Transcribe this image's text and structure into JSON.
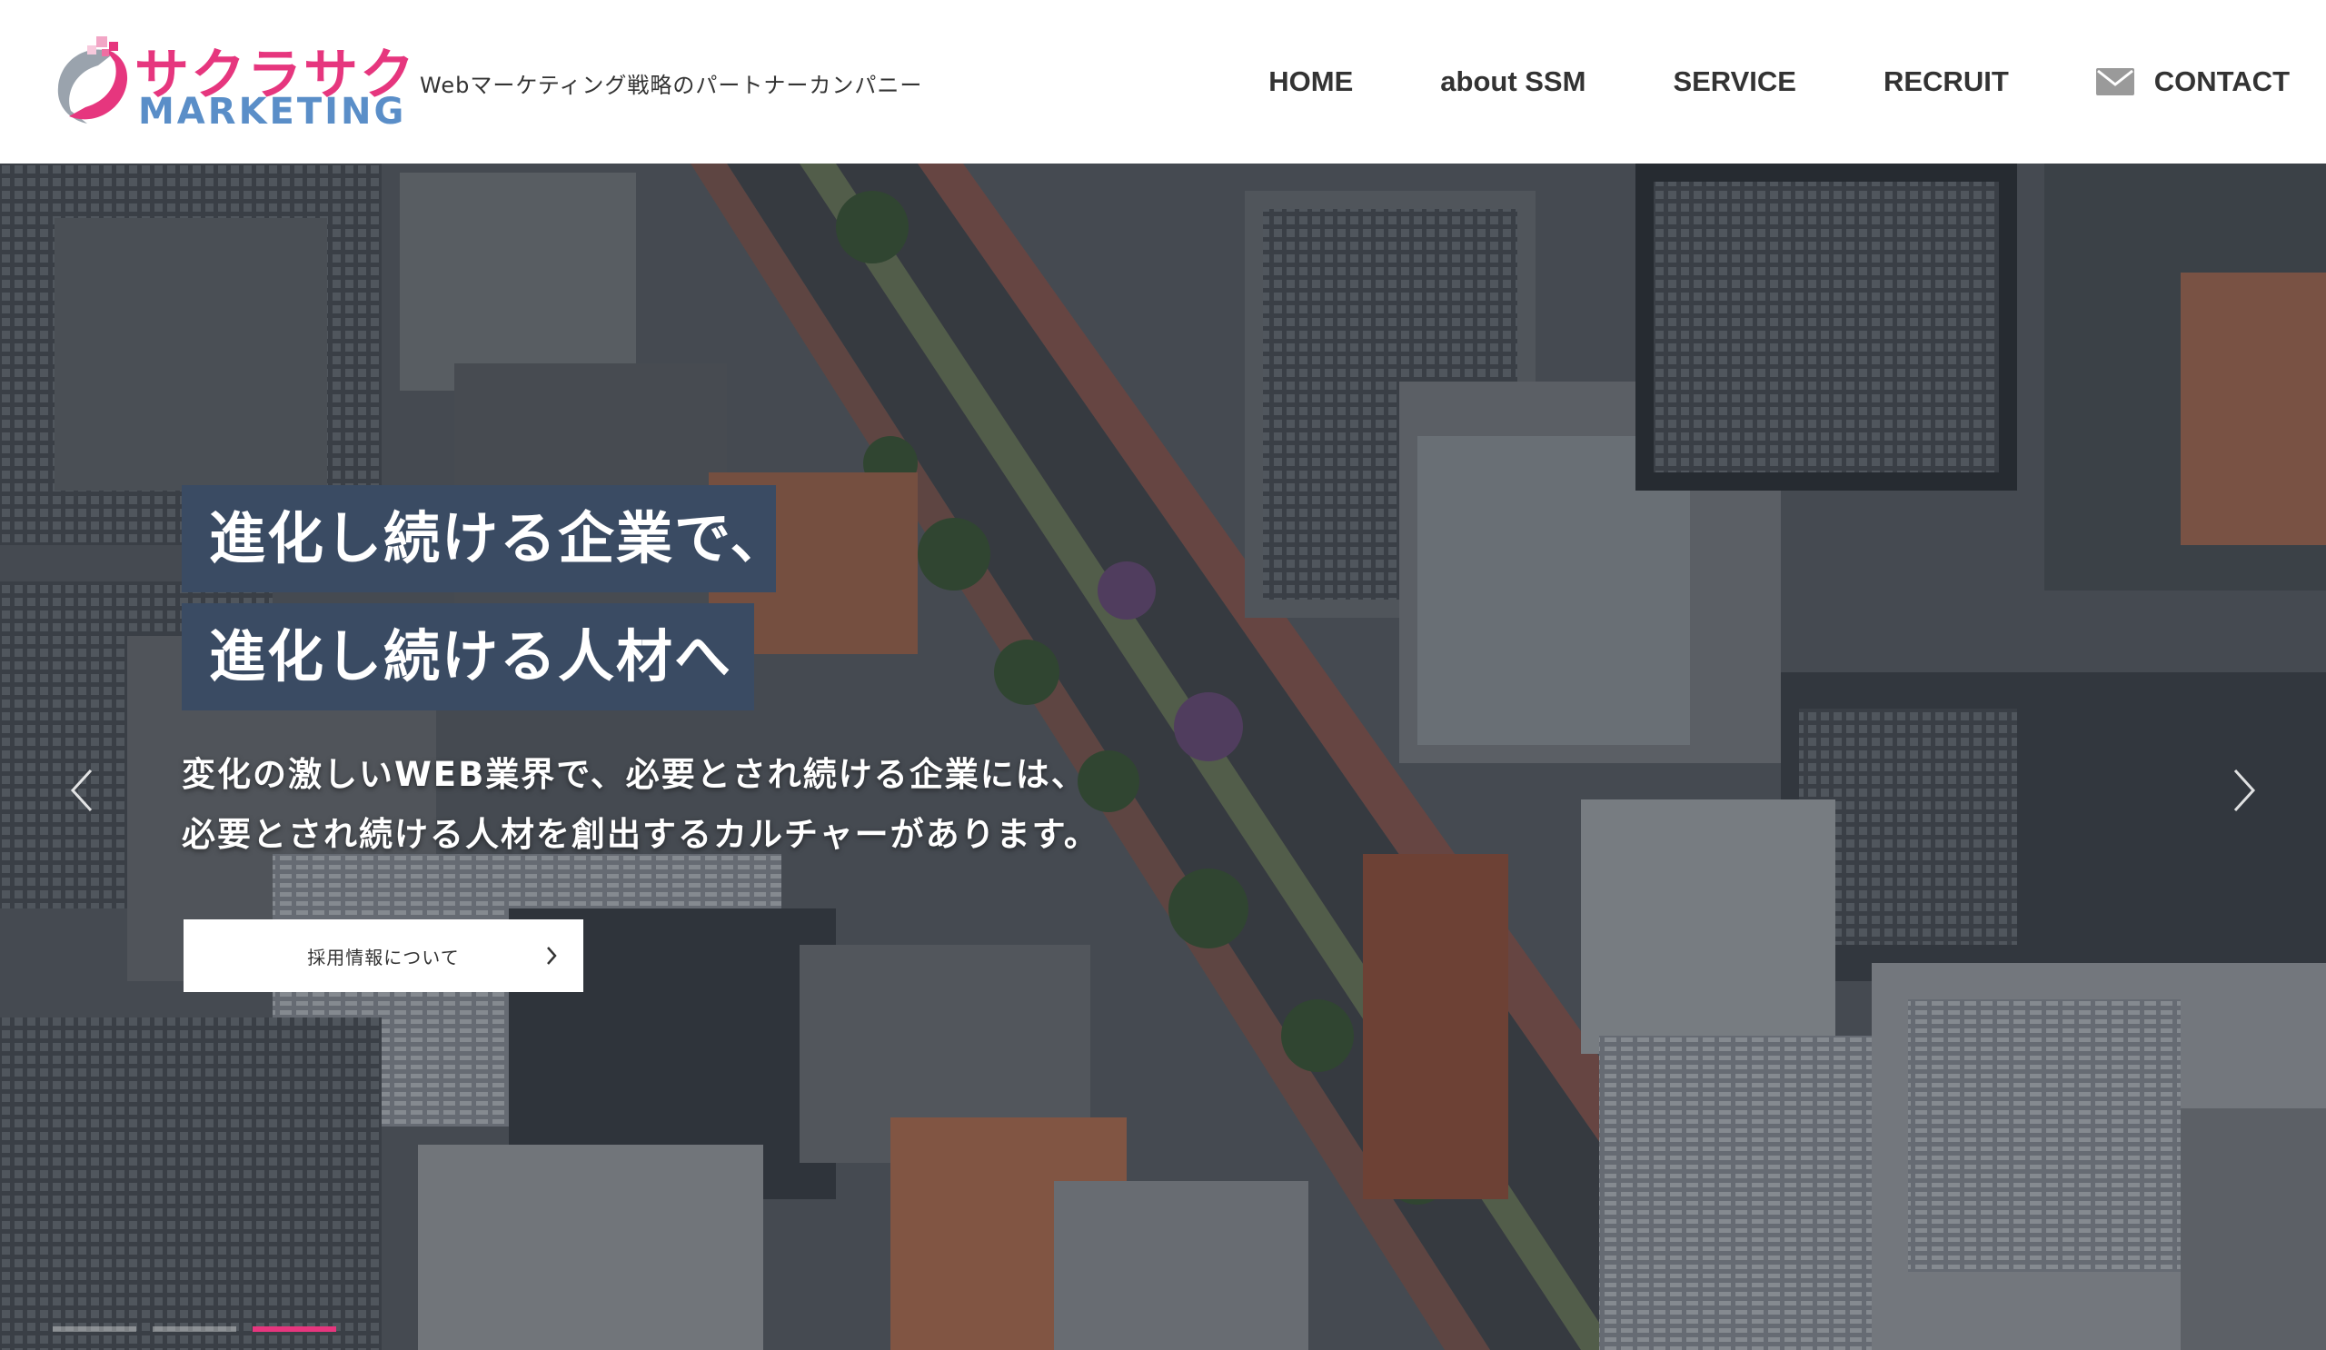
{
  "header": {
    "logo": {
      "text_jp": "サクラサク",
      "text_en": "MARKETING"
    },
    "tagline": "Webマーケティング戦略のパートナーカンパニー",
    "nav": [
      {
        "label": "HOME"
      },
      {
        "label": "about SSM"
      },
      {
        "label": "SERVICE"
      },
      {
        "label": "RECRUIT"
      },
      {
        "label": "CONTACT",
        "icon": "mail-icon"
      }
    ]
  },
  "hero": {
    "headline_line1": "進化し続ける企業で、",
    "headline_line2": "進化し続ける人材へ",
    "lead_line1": "変化の激しいWEB業界で、必要とされ続ける企業には、",
    "lead_line2": "必要とされ続ける人材を創出するカルチャーがあります。",
    "cta_label": "採用情報について",
    "cta_icon": "chevron-right-icon",
    "prev_icon": "chevron-left-icon",
    "next_icon": "chevron-right-icon",
    "slides": {
      "count": 3,
      "active_index": 2
    }
  },
  "colors": {
    "brand_pink": "#e6367e",
    "brand_blue": "#5a8ec8",
    "headline_bg": "#3a4b63",
    "nav_text": "#333333"
  }
}
